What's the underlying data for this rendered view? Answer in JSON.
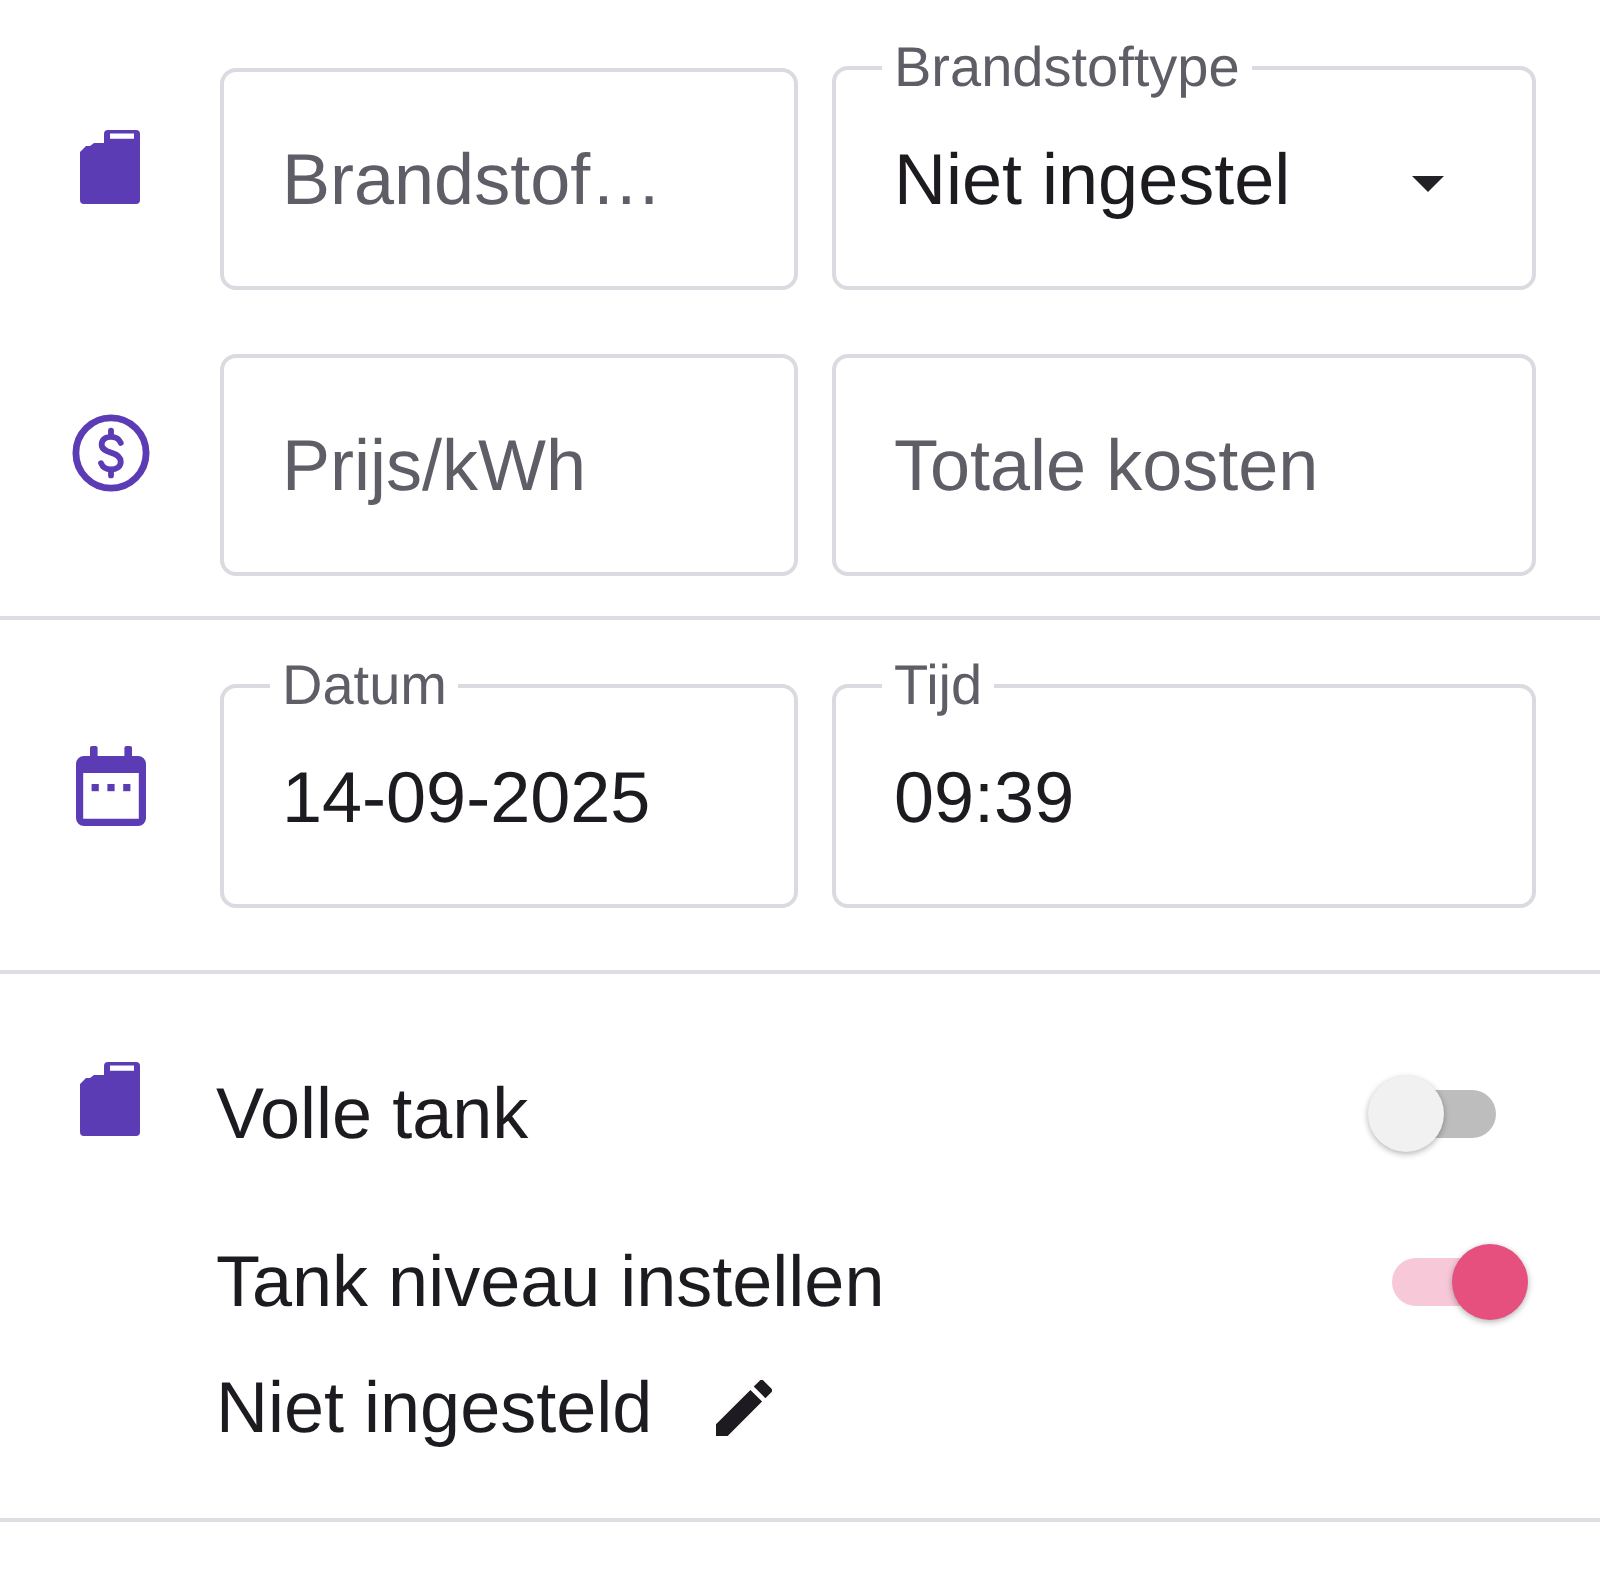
{
  "form_sections": [
    {
      "rows": [
        {
          "kind": "fuel",
          "fields": [
            {
              "kind": "input",
              "placeholder": "Brandstof…"
            },
            {
              "kind": "select",
              "label": "Brandstoftype",
              "value": "Niet ingestel"
            }
          ]
        },
        {
          "kind": "price",
          "fields": [
            {
              "kind": "input",
              "placeholder": "Prijs/kWh"
            },
            {
              "kind": "input",
              "placeholder": "Totale kosten"
            }
          ]
        }
      ]
    },
    {
      "rows": [
        {
          "kind": "date",
          "fields": [
            {
              "kind": "input",
              "label": "Datum",
              "value": "14-09-2025"
            },
            {
              "kind": "input",
              "label": "Tijd",
              "value": "09:39"
            }
          ]
        }
      ]
    }
  ],
  "tank": {
    "toggles": [
      {
        "label": "Volle tank",
        "on": false
      },
      {
        "label": "Tank niveau instellen",
        "on": true
      }
    ],
    "level_value": "Niet ingesteld"
  }
}
